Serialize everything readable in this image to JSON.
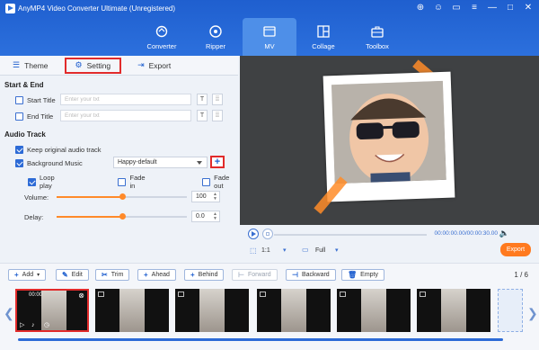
{
  "app": {
    "title": "AnyMP4 Video Converter Ultimate (Unregistered)"
  },
  "window_controls": [
    "cart-icon",
    "person-icon",
    "message-icon",
    "menu-icon",
    "minimize-icon",
    "maximize-icon",
    "close-icon"
  ],
  "nav": [
    {
      "label": "Converter",
      "icon": "converter-icon",
      "active": false
    },
    {
      "label": "Ripper",
      "icon": "ripper-icon",
      "active": false
    },
    {
      "label": "MV",
      "icon": "mv-icon",
      "active": true
    },
    {
      "label": "Collage",
      "icon": "collage-icon",
      "active": false
    },
    {
      "label": "Toolbox",
      "icon": "toolbox-icon",
      "active": false
    }
  ],
  "tabs": [
    {
      "label": "Theme",
      "icon": "theme-icon"
    },
    {
      "label": "Setting",
      "icon": "gear-icon",
      "active": true
    },
    {
      "label": "Export",
      "icon": "export-icon"
    }
  ],
  "start_end": {
    "title": "Start & End",
    "start_title": {
      "label": "Start Title",
      "placeholder": "Enter your txt",
      "checked": false
    },
    "end_title": {
      "label": "End Title",
      "placeholder": "Enter your txt",
      "checked": false
    }
  },
  "audio": {
    "title": "Audio Track",
    "keep_original": {
      "label": "Keep original audio track",
      "checked": true
    },
    "background_music": {
      "label": "Background Music",
      "checked": true,
      "selected": "Happy-default"
    },
    "add_symbol": "+",
    "loop_play": {
      "label": "Loop play",
      "checked": true
    },
    "fade_in": {
      "label": "Fade in",
      "checked": false
    },
    "fade_out": {
      "label": "Fade out",
      "checked": false
    },
    "volume": {
      "label": "Volume:",
      "value": "100",
      "level": 0.5
    },
    "delay": {
      "label": "Delay:",
      "value": "0.0",
      "level": 0.5
    }
  },
  "player": {
    "time": "00:00:00.00/00:00:30.00",
    "ratio": "1:1",
    "zoom": "Full",
    "export_label": "Export"
  },
  "toolbar": {
    "add": "Add",
    "edit": "Edit",
    "trim": "Trim",
    "ahead": "Ahead",
    "behind": "Behind",
    "forward": "Forward",
    "backward": "Backward",
    "empty": "Empty",
    "page": "1 / 6"
  },
  "timeline": {
    "first_clip_time": "00:00"
  },
  "colors": {
    "accent": "#2c70dd",
    "export": "#ff7a1f",
    "highlight": "#e12b2b"
  }
}
